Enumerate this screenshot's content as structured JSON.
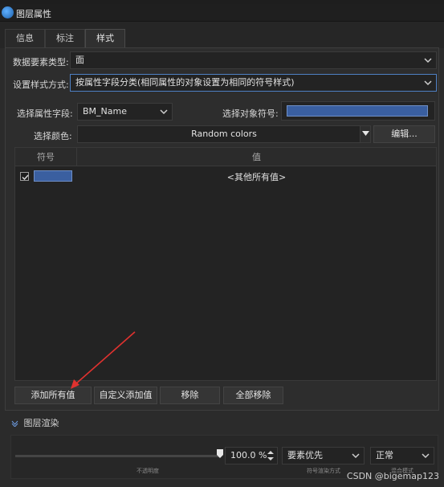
{
  "titlebar": {
    "title": "图层属性"
  },
  "tabs": [
    {
      "label": "信息",
      "active": false
    },
    {
      "label": "标注",
      "active": false
    },
    {
      "label": "样式",
      "active": true
    }
  ],
  "style": {
    "element_type_label": "数据要素类型:",
    "element_type_value": "面",
    "style_mode_label": "设置样式方式:",
    "style_mode_value": "按属性字段分类(相同属性的对象设置为相同的符号样式)",
    "field_label": "选择属性字段:",
    "field_value": "BM_Name",
    "symbol_label": "选择对象符号:",
    "color_label": "选择颜色:",
    "color_value": "Random colors",
    "edit_button": "编辑..."
  },
  "table": {
    "columns": [
      "符号",
      "值"
    ],
    "rows": [
      {
        "checked": true,
        "value": "<其他所有值>"
      }
    ]
  },
  "buttons": {
    "add_all": "添加所有值",
    "custom_add": "自定义添加值",
    "remove": "移除",
    "remove_all": "全部移除"
  },
  "render": {
    "section_title": "图层渲染",
    "opacity_value": "100.0 %",
    "opacity_label": "不透明度",
    "render_mode_value": "要素优先",
    "render_mode_label": "符号渲染方式",
    "blend_mode_value": "正常",
    "blend_mode_label": "混合模式"
  },
  "watermark": "CSDN @bigemap123",
  "colors": {
    "accent": "#4e80c4",
    "symbol_fill": "#3a5fa0",
    "annotation_arrow": "#e0322f"
  }
}
